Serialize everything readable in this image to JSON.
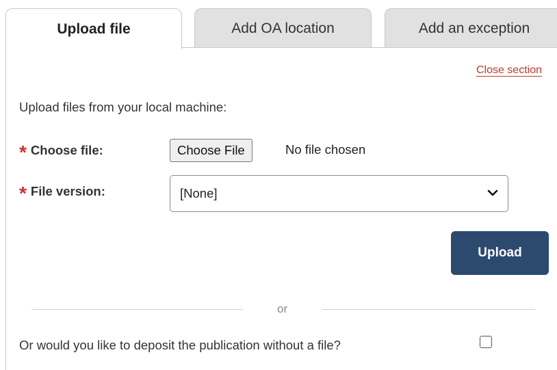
{
  "tabs": [
    {
      "label": "Upload file",
      "active": true
    },
    {
      "label": "Add OA location",
      "active": false
    },
    {
      "label": "Add an exception",
      "active": false
    }
  ],
  "panel": {
    "close_link": "Close section",
    "intro": "Upload files from your local machine:",
    "required_mark": "*",
    "choose_file": {
      "label": "Choose file:",
      "button_label": "Choose File",
      "status": "No file chosen"
    },
    "file_version": {
      "label": "File version:",
      "selected": "[None]"
    },
    "upload_button": "Upload",
    "divider_text": "or",
    "deposit_question": "Or would you like to deposit the publication without a file?",
    "deposit_checked": false
  },
  "colors": {
    "accent": "#2c4a6e",
    "required": "#d32f2f",
    "link": "#c0392b",
    "inactive_tab": "#e1e1e1"
  }
}
